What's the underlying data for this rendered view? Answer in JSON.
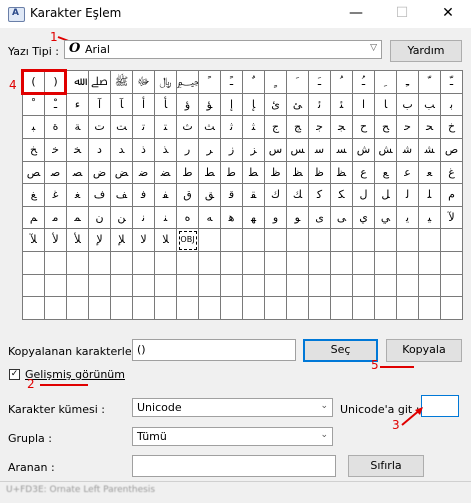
{
  "window": {
    "title": "Karakter Eşlem",
    "minimize": "—",
    "maximize": "☐",
    "close": "✕"
  },
  "font": {
    "label": "Yazı Tipi :",
    "value": "Arial",
    "glyph": "O"
  },
  "help_button": "Yardım",
  "grid_cells": [
    "(",
    ")",
    "ﷲ",
    "ﷰ",
    "ﷺ",
    "ﷻ",
    "﷼",
    "﷽",
    "ﹰ",
    "ﹱ",
    "ﹲ",
    "ﹴ",
    "ﹶ",
    "ﹷ",
    "ﹸ",
    "ﹹ",
    "ﹺ",
    "ﹻ",
    "ﹼ",
    "ﹽ",
    "ﹾ",
    "ﹿ",
    "ﺀ",
    "ﺁ",
    "ﺂ",
    "ﺃ",
    "ﺄ",
    "ﺅ",
    "ﺆ",
    "ﺇ",
    "ﺈ",
    "ﺉ",
    "ﺊ",
    "ﺋ",
    "ﺌ",
    "ﺍ",
    "ﺎ",
    "ﺏ",
    "ﺐ",
    "ﺑ",
    "ﺒ",
    "ﺓ",
    "ﺔ",
    "ﺕ",
    "ﺖ",
    "ﺗ",
    "ﺘ",
    "ﺙ",
    "ﺚ",
    "ﺛ",
    "ﺜ",
    "ﺝ",
    "ﺞ",
    "ﺟ",
    "ﺠ",
    "ﺡ",
    "ﺢ",
    "ﺣ",
    "ﺤ",
    "ﺥ",
    "ﺦ",
    "ﺧ",
    "ﺨ",
    "ﺩ",
    "ﺪ",
    "ﺫ",
    "ﺬ",
    "ﺭ",
    "ﺮ",
    "ﺯ",
    "ﺰ",
    "ﺱ",
    "ﺲ",
    "ﺳ",
    "ﺴ",
    "ﺵ",
    "ﺶ",
    "ﺷ",
    "ﺸ",
    "ﺹ",
    "ﺺ",
    "ﺻ",
    "ﺼ",
    "ﺽ",
    "ﺾ",
    "ﺿ",
    "ﻀ",
    "ﻁ",
    "ﻂ",
    "ﻃ",
    "ﻄ",
    "ﻅ",
    "ﻆ",
    "ﻇ",
    "ﻈ",
    "ﻉ",
    "ﻊ",
    "ﻋ",
    "ﻌ",
    "ﻍ",
    "ﻎ",
    "ﻏ",
    "ﻐ",
    "ﻑ",
    "ﻒ",
    "ﻓ",
    "ﻔ",
    "ﻕ",
    "ﻖ",
    "ﻗ",
    "ﻘ",
    "ﻙ",
    "ﻚ",
    "ﻛ",
    "ﻜ",
    "ﻝ",
    "ﻞ",
    "ﻟ",
    "ﻠ",
    "ﻡ",
    "ﻢ",
    "ﻣ",
    "ﻤ",
    "ﻥ",
    "ﻦ",
    "ﻧ",
    "ﻨ",
    "ﻩ",
    "ﻪ",
    "ﻫ",
    "ﻬ",
    "ﻭ",
    "ﻮ",
    "ﻯ",
    "ﻰ",
    "ﻱ",
    "ﻲ",
    "ﻳ",
    "ﻴ",
    "ﻵ",
    "ﻶ",
    "ﻷ",
    "ﻸ",
    "ﻹ",
    "ﻺ",
    "ﻻ",
    "ﻼ",
    "OBJ",
    "",
    "",
    "",
    "",
    "",
    "",
    "",
    "",
    "",
    "",
    "",
    "",
    "",
    "",
    "",
    "",
    "",
    "",
    "",
    "",
    "",
    "",
    "",
    "",
    "",
    "",
    "",
    "",
    "",
    "",
    "",
    "",
    "",
    "",
    "",
    "",
    "",
    "",
    "",
    "",
    "",
    "",
    "",
    "",
    "",
    "",
    "",
    "",
    "",
    "",
    "",
    "",
    "",
    "",
    "",
    "",
    "",
    "",
    "",
    "",
    "",
    "",
    "",
    "",
    "",
    "",
    "",
    "",
    "",
    "",
    "",
    ""
  ],
  "copy": {
    "label": "Kopyalanan karakterler :",
    "value": "()",
    "select_button": "Seç",
    "copy_button": "Kopyala"
  },
  "advanced": {
    "label": "Gelişmiş görünüm",
    "checked": "✓"
  },
  "charset": {
    "label": "Karakter kümesi :",
    "value": "Unicode"
  },
  "unicode_goto": {
    "label": "Unicode'a git :",
    "value": ""
  },
  "group": {
    "label": "Grupla :",
    "value": "Tümü"
  },
  "search": {
    "label": "Aranan :",
    "value": "",
    "clear_button": "Sıfırla"
  },
  "status": {
    "text": "U+FD3E: Ornate Left Parenthesis"
  },
  "annotations": {
    "a1": "1",
    "a2": "2",
    "a3": "3",
    "a4": "4",
    "a5": "5",
    "color": "#e00000"
  }
}
